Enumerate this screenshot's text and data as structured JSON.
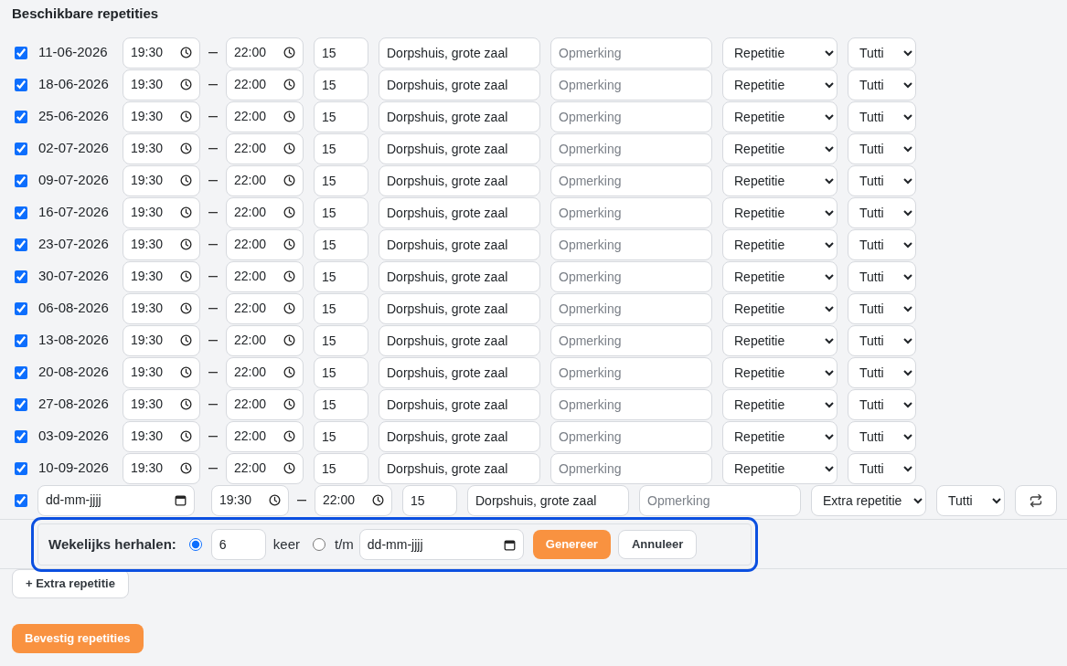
{
  "title": "Beschikbare repetities",
  "rows": [
    {
      "checked": true,
      "date": "11-06-2026",
      "start": "19:30",
      "end": "22:00",
      "count": "15",
      "location": "Dorpshuis, grote zaal",
      "remark_placeholder": "Opmerking",
      "type": "Repetitie",
      "group": "Tutti"
    },
    {
      "checked": true,
      "date": "18-06-2026",
      "start": "19:30",
      "end": "22:00",
      "count": "15",
      "location": "Dorpshuis, grote zaal",
      "remark_placeholder": "Opmerking",
      "type": "Repetitie",
      "group": "Tutti"
    },
    {
      "checked": true,
      "date": "25-06-2026",
      "start": "19:30",
      "end": "22:00",
      "count": "15",
      "location": "Dorpshuis, grote zaal",
      "remark_placeholder": "Opmerking",
      "type": "Repetitie",
      "group": "Tutti"
    },
    {
      "checked": true,
      "date": "02-07-2026",
      "start": "19:30",
      "end": "22:00",
      "count": "15",
      "location": "Dorpshuis, grote zaal",
      "remark_placeholder": "Opmerking",
      "type": "Repetitie",
      "group": "Tutti"
    },
    {
      "checked": true,
      "date": "09-07-2026",
      "start": "19:30",
      "end": "22:00",
      "count": "15",
      "location": "Dorpshuis, grote zaal",
      "remark_placeholder": "Opmerking",
      "type": "Repetitie",
      "group": "Tutti"
    },
    {
      "checked": true,
      "date": "16-07-2026",
      "start": "19:30",
      "end": "22:00",
      "count": "15",
      "location": "Dorpshuis, grote zaal",
      "remark_placeholder": "Opmerking",
      "type": "Repetitie",
      "group": "Tutti"
    },
    {
      "checked": true,
      "date": "23-07-2026",
      "start": "19:30",
      "end": "22:00",
      "count": "15",
      "location": "Dorpshuis, grote zaal",
      "remark_placeholder": "Opmerking",
      "type": "Repetitie",
      "group": "Tutti"
    },
    {
      "checked": true,
      "date": "30-07-2026",
      "start": "19:30",
      "end": "22:00",
      "count": "15",
      "location": "Dorpshuis, grote zaal",
      "remark_placeholder": "Opmerking",
      "type": "Repetitie",
      "group": "Tutti"
    },
    {
      "checked": true,
      "date": "06-08-2026",
      "start": "19:30",
      "end": "22:00",
      "count": "15",
      "location": "Dorpshuis, grote zaal",
      "remark_placeholder": "Opmerking",
      "type": "Repetitie",
      "group": "Tutti"
    },
    {
      "checked": true,
      "date": "13-08-2026",
      "start": "19:30",
      "end": "22:00",
      "count": "15",
      "location": "Dorpshuis, grote zaal",
      "remark_placeholder": "Opmerking",
      "type": "Repetitie",
      "group": "Tutti"
    },
    {
      "checked": true,
      "date": "20-08-2026",
      "start": "19:30",
      "end": "22:00",
      "count": "15",
      "location": "Dorpshuis, grote zaal",
      "remark_placeholder": "Opmerking",
      "type": "Repetitie",
      "group": "Tutti"
    },
    {
      "checked": true,
      "date": "27-08-2026",
      "start": "19:30",
      "end": "22:00",
      "count": "15",
      "location": "Dorpshuis, grote zaal",
      "remark_placeholder": "Opmerking",
      "type": "Repetitie",
      "group": "Tutti"
    },
    {
      "checked": true,
      "date": "03-09-2026",
      "start": "19:30",
      "end": "22:00",
      "count": "15",
      "location": "Dorpshuis, grote zaal",
      "remark_placeholder": "Opmerking",
      "type": "Repetitie",
      "group": "Tutti"
    },
    {
      "checked": true,
      "date": "10-09-2026",
      "start": "19:30",
      "end": "22:00",
      "count": "15",
      "location": "Dorpshuis, grote zaal",
      "remark_placeholder": "Opmerking",
      "type": "Repetitie",
      "group": "Tutti"
    }
  ],
  "new_row": {
    "checked": true,
    "date_placeholder": "dd-mm-jjjj",
    "start": "19:30",
    "end": "22:00",
    "count": "15",
    "location": "Dorpshuis, grote zaal",
    "remark_placeholder": "Opmerking",
    "type": "Extra repetitie",
    "group": "Tutti"
  },
  "repeat_panel": {
    "highlighted": true,
    "label": "Wekelijks herhalen:",
    "options": [
      {
        "kind": "count",
        "selected": true,
        "value": "6",
        "label": "keer"
      },
      {
        "kind": "until",
        "selected": false,
        "label": "t/m",
        "placeholder": "dd-mm-jjjj"
      }
    ],
    "generate_button": "Genereer",
    "cancel_button": "Annuleer"
  },
  "add_button": "+ Extra repetitie",
  "confirm_button": "Bevestig repetities"
}
